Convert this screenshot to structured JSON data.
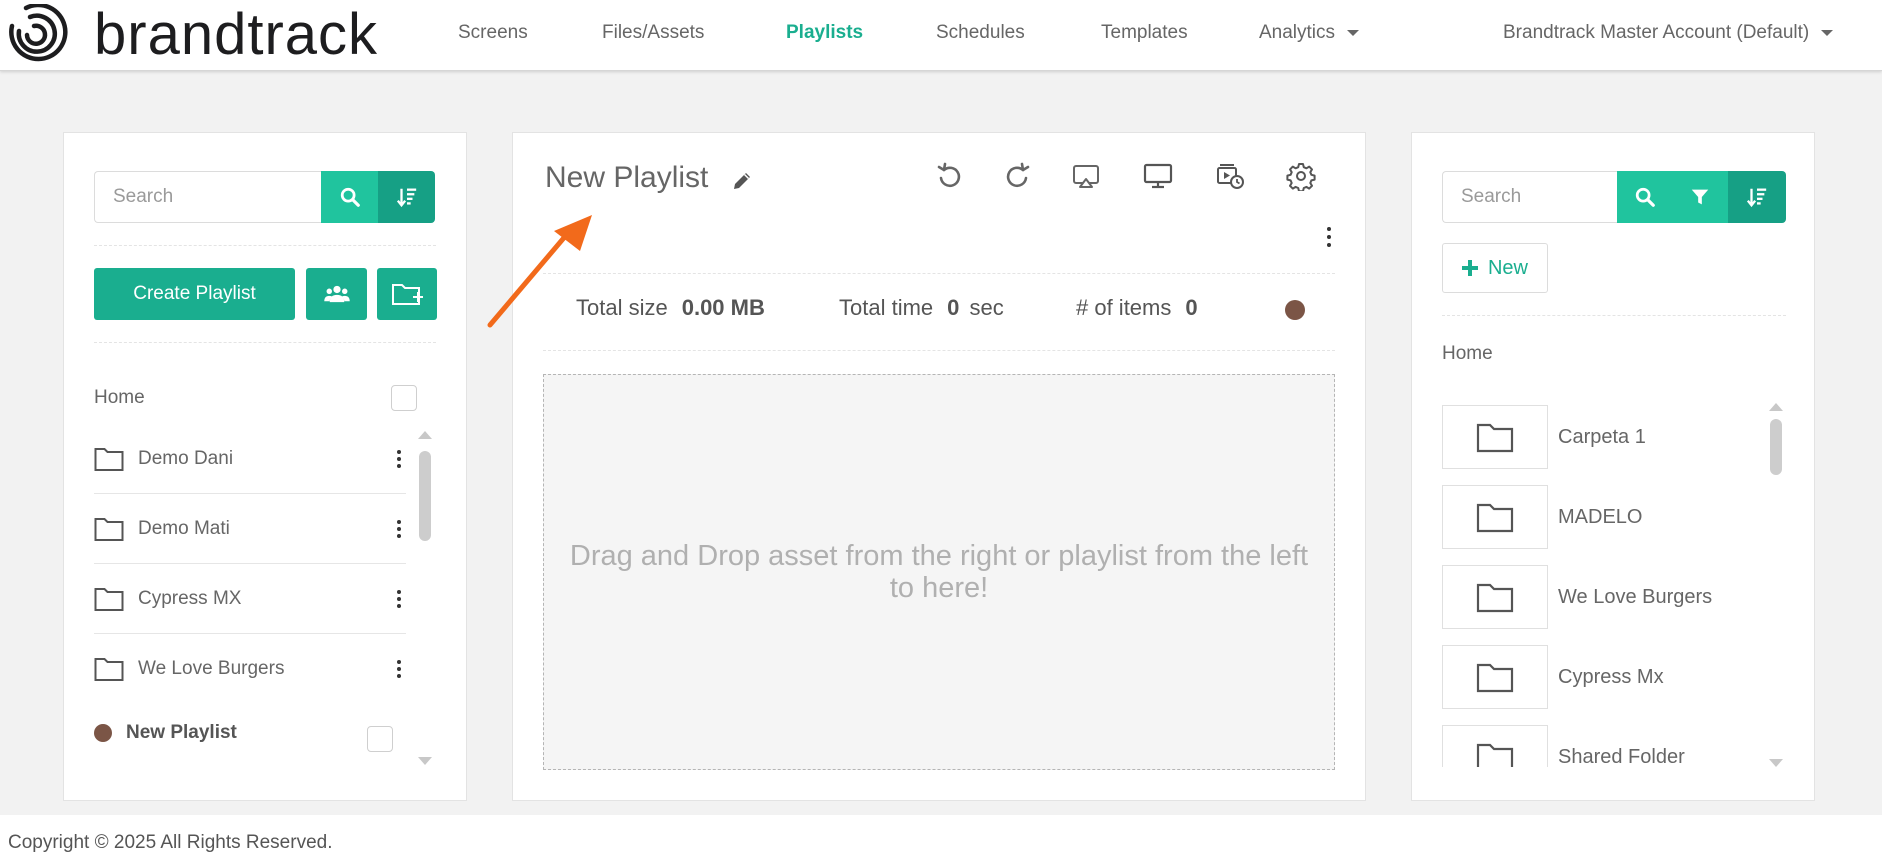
{
  "colors": {
    "accent": "#1aae8f",
    "accent_light": "#20c49e",
    "accent_dark": "#16a085",
    "arrow": "#f26a1b",
    "playlist_dot": "#7b5546"
  },
  "logo": {
    "text": "brandtrack"
  },
  "nav": {
    "items": [
      {
        "label": "Screens"
      },
      {
        "label": "Files/Assets"
      },
      {
        "label": "Playlists",
        "active": true
      },
      {
        "label": "Schedules"
      },
      {
        "label": "Templates"
      },
      {
        "label": "Analytics"
      }
    ],
    "account": "Brandtrack Master Account (Default)"
  },
  "left": {
    "search_placeholder": "Search",
    "create_label": "Create Playlist",
    "home_label": "Home",
    "folders": [
      {
        "label": "Demo Dani"
      },
      {
        "label": "Demo Mati"
      },
      {
        "label": "Cypress MX"
      },
      {
        "label": "We Love Burgers"
      }
    ],
    "playlist": {
      "label": "New Playlist"
    }
  },
  "middle": {
    "title": "New Playlist",
    "stats": {
      "size_label": "Total size",
      "size_value": "0.00 MB",
      "time_label": "Total time",
      "time_value": "0",
      "time_unit": "sec",
      "items_label": "# of items",
      "items_value": "0"
    },
    "dropzone_text": "Drag and Drop asset from the right or playlist from the left to here!"
  },
  "right": {
    "search_placeholder": "Search",
    "new_label": "New",
    "home_label": "Home",
    "assets": [
      {
        "label": "Carpeta 1"
      },
      {
        "label": "MADELO"
      },
      {
        "label": "We Love Burgers"
      },
      {
        "label": "Cypress Mx"
      },
      {
        "label": "Shared Folder"
      }
    ]
  },
  "footer": {
    "text": "Copyright © 2025 All Rights Reserved."
  }
}
